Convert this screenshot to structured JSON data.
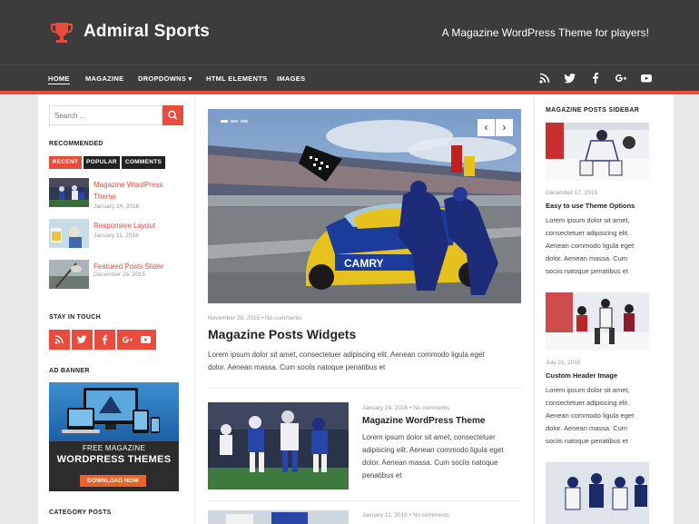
{
  "header": {
    "site_title": "Admiral Sports",
    "tagline": "A Magazine WordPress Theme for players!",
    "logo_icon": "trophy-icon",
    "accent": "#e84c3d"
  },
  "nav": {
    "items": [
      "HOME",
      "MAGAZINE",
      "DROPDOWNS",
      "HTML ELEMENTS",
      "IMAGES"
    ],
    "dropdown_caret": "▾",
    "social": [
      "rss-icon",
      "twitter-icon",
      "facebook-icon",
      "google-plus-icon",
      "youtube-icon"
    ]
  },
  "left_sidebar": {
    "search_placeholder": "Search ...",
    "recommended_title": "RECOMMENDED",
    "tabs": [
      "RECENT",
      "POPULAR",
      "COMMENTS"
    ],
    "recent_posts": [
      {
        "title_line1": "Magazine WordPress",
        "title_line2": "Theme",
        "date": "January 24, 2016"
      },
      {
        "title_line1": "Responsive Layout",
        "title_line2": "",
        "date": "January 11, 2016"
      },
      {
        "title_line1": "Featured Posts Slider",
        "title_line2": "",
        "date": "December 26, 2015"
      }
    ],
    "stay_in_touch_title": "STAY IN TOUCH",
    "social_buttons": [
      "rss-icon",
      "twitter-icon",
      "facebook-icon",
      "google-plus-icon",
      "youtube-icon"
    ],
    "ad_banner_title": "AD BANNER",
    "ad": {
      "line1": "FREE MAGAZINE",
      "line2": "WORDPRESS THEMES",
      "button": "DOWNLOAD NOW"
    },
    "category_posts_title": "CATEGORY POSTS"
  },
  "main": {
    "slider": {
      "prev": "‹",
      "next": "›"
    },
    "featured": {
      "date": "November 28, 2015",
      "comments": "No comments",
      "title": "Magazine Posts Widgets",
      "excerpt_line1": "Lorem ipsum dolor sit amet, consectetuer adipiscing elit. Aenean commodo ligula eget",
      "excerpt_line2": "dolor. Aenean massa. Cum sociis natoque penatibus et"
    },
    "post2": {
      "date": "January 24, 2016",
      "comments": "No comments",
      "title": "Magazine WordPress Theme",
      "excerpt": [
        "Lorem ipsum dolor sit amet, consectetuer",
        "adipiscing elit. Aenean commodo ligula eget",
        "dolor. Aenean massa. Cum sociis natoque",
        "penatibus et"
      ]
    },
    "post3": {
      "date": "January 11, 2016",
      "comments": "No comments"
    },
    "meta_separator": "•"
  },
  "right_sidebar": {
    "title": "MAGAZINE POSTS SIDEBAR",
    "posts": [
      {
        "date": "December 17, 2015",
        "title": "Easy to use Theme Options",
        "excerpt": [
          "Lorem ipsum dolor sit amet,",
          "consectetuer adipiscing elit.",
          "Aenean commodo ligula eget",
          "dolor. Aenean massa. Cum",
          "sociis natoque penatibus et"
        ]
      },
      {
        "date": "July 21, 2015",
        "title": "Custom Header Image",
        "excerpt": [
          "Lorem ipsum dolor sit amet,",
          "consectetuer adipiscing elit.",
          "Aenean commodo ligula eget",
          "dolor. Aenean massa. Cum",
          "sociis natoque penatibus et"
        ]
      }
    ]
  }
}
